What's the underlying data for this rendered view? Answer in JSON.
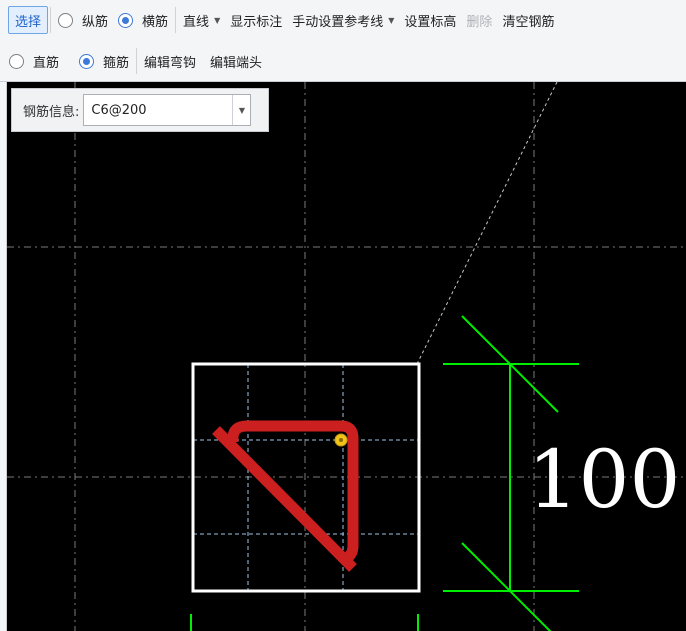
{
  "toolbar": {
    "row1": {
      "select": "选择",
      "radio_longitudinal": "纵筋",
      "radio_transverse": "横筋",
      "straight_line": "直线",
      "show_annotation": "显示标注",
      "manual_reference_line": "手动设置参考线",
      "set_elevation": "设置标高",
      "delete": "删除",
      "clear_rebar": "清空钢筋"
    },
    "row2": {
      "radio_straight": "直筋",
      "radio_stirrup": "箍筋",
      "edit_hook": "编辑弯钩",
      "edit_end": "编辑端头"
    },
    "radio_state": {
      "longitudinal": false,
      "transverse": true,
      "straight": false,
      "stirrup": true
    }
  },
  "rebar_info": {
    "label": "钢筋信息:",
    "value": "C6@200"
  },
  "canvas": {
    "dimension_text": "100",
    "colors": {
      "background": "#000000",
      "section_outline": "#ffffff",
      "stirrup": "#cc1f1f",
      "dimension": "#00ee00",
      "grid": "#7a7a7a",
      "snap_point": "#f0c419"
    }
  }
}
